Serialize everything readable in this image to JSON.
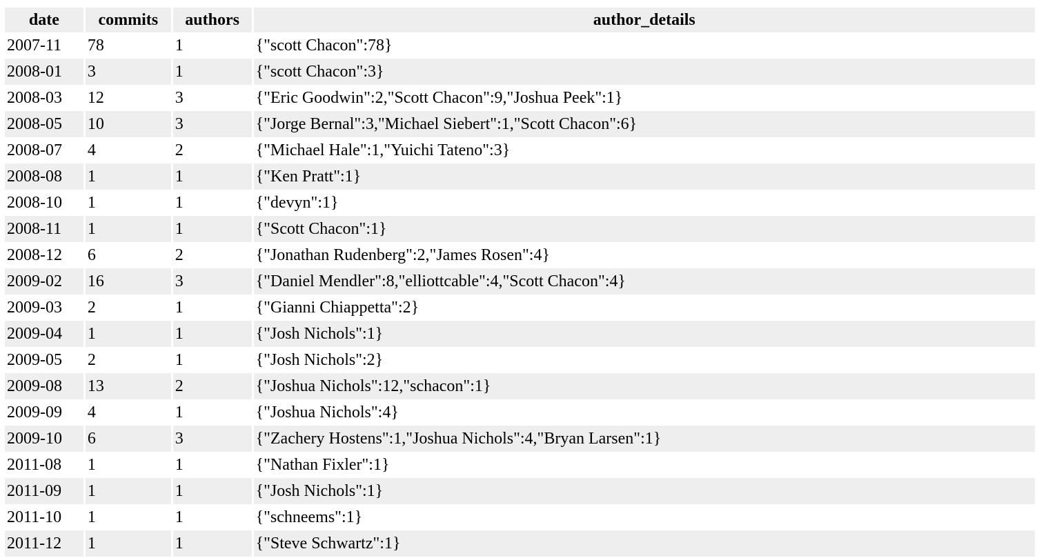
{
  "table": {
    "headers": [
      "date",
      "commits",
      "authors",
      "author_details"
    ],
    "rows": [
      [
        "2007-11",
        "78",
        "1",
        "{\"scott Chacon\":78}"
      ],
      [
        "2008-01",
        "3",
        "1",
        "{\"scott Chacon\":3}"
      ],
      [
        "2008-03",
        "12",
        "3",
        "{\"Eric Goodwin\":2,\"Scott Chacon\":9,\"Joshua Peek\":1}"
      ],
      [
        "2008-05",
        "10",
        "3",
        "{\"Jorge Bernal\":3,\"Michael Siebert\":1,\"Scott Chacon\":6}"
      ],
      [
        "2008-07",
        "4",
        "2",
        "{\"Michael Hale\":1,\"Yuichi Tateno\":3}"
      ],
      [
        "2008-08",
        "1",
        "1",
        "{\"Ken Pratt\":1}"
      ],
      [
        "2008-10",
        "1",
        "1",
        "{\"devyn\":1}"
      ],
      [
        "2008-11",
        "1",
        "1",
        "{\"Scott Chacon\":1}"
      ],
      [
        "2008-12",
        "6",
        "2",
        "{\"Jonathan Rudenberg\":2,\"James Rosen\":4}"
      ],
      [
        "2009-02",
        "16",
        "3",
        "{\"Daniel Mendler\":8,\"elliottcable\":4,\"Scott Chacon\":4}"
      ],
      [
        "2009-03",
        "2",
        "1",
        "{\"Gianni Chiappetta\":2}"
      ],
      [
        "2009-04",
        "1",
        "1",
        "{\"Josh Nichols\":1}"
      ],
      [
        "2009-05",
        "2",
        "1",
        "{\"Josh Nichols\":2}"
      ],
      [
        "2009-08",
        "13",
        "2",
        "{\"Joshua Nichols\":12,\"schacon\":1}"
      ],
      [
        "2009-09",
        "4",
        "1",
        "{\"Joshua Nichols\":4}"
      ],
      [
        "2009-10",
        "6",
        "3",
        "{\"Zachery Hostens\":1,\"Joshua Nichols\":4,\"Bryan Larsen\":1}"
      ],
      [
        "2011-08",
        "1",
        "1",
        "{\"Nathan Fixler\":1}"
      ],
      [
        "2011-09",
        "1",
        "1",
        "{\"Josh Nichols\":1}"
      ],
      [
        "2011-10",
        "1",
        "1",
        "{\"schneems\":1}"
      ],
      [
        "2011-12",
        "1",
        "1",
        "{\"Steve Schwartz\":1}"
      ]
    ]
  }
}
